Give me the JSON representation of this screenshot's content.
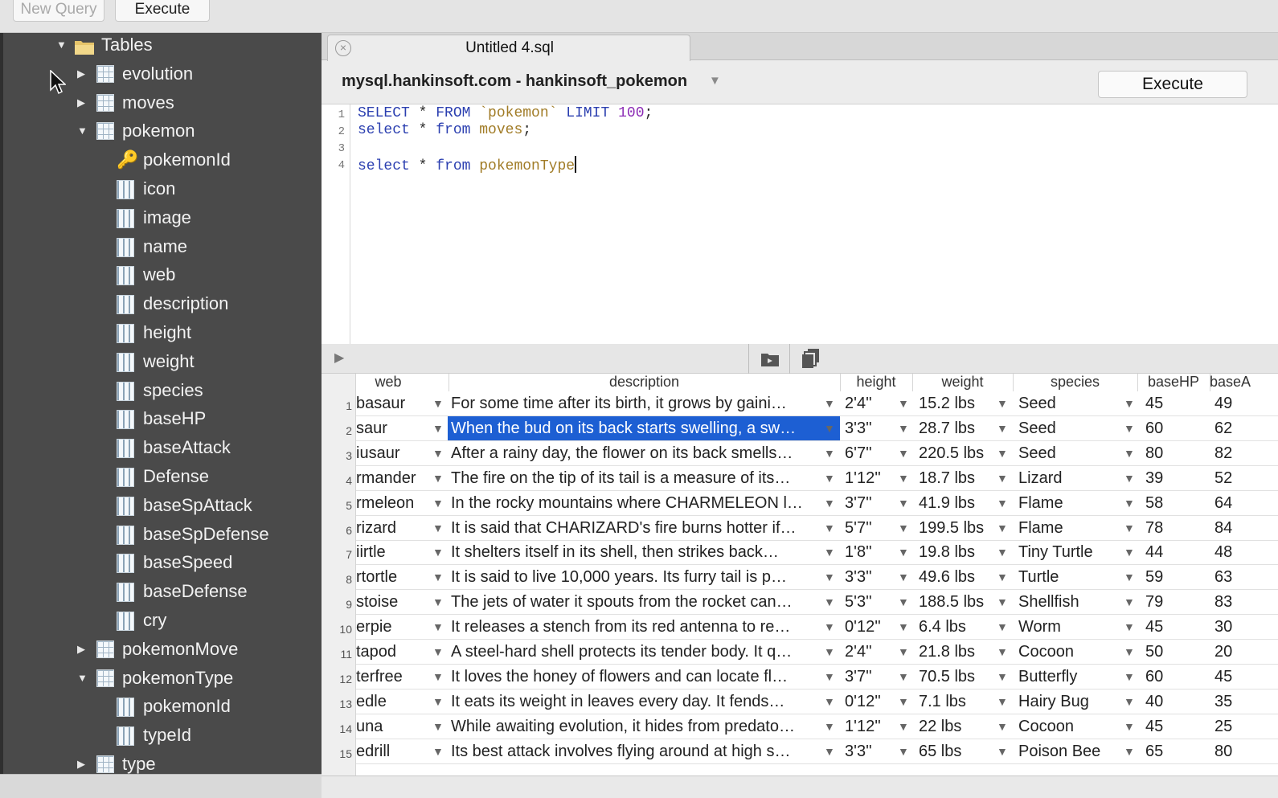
{
  "toolbar": {
    "new_query": "New Query",
    "execute": "Execute"
  },
  "sidebar": {
    "items": [
      {
        "label": "Tables",
        "kind": "folder",
        "level": 0,
        "state": "expanded"
      },
      {
        "label": "evolution",
        "kind": "table",
        "level": 1,
        "state": "collapsed"
      },
      {
        "label": "moves",
        "kind": "table",
        "level": 1,
        "state": "collapsed"
      },
      {
        "label": "pokemon",
        "kind": "table",
        "level": 1,
        "state": "expanded"
      },
      {
        "label": "pokemonId",
        "kind": "key",
        "level": 2
      },
      {
        "label": "icon",
        "kind": "column",
        "level": 2
      },
      {
        "label": "image",
        "kind": "column",
        "level": 2
      },
      {
        "label": "name",
        "kind": "column",
        "level": 2
      },
      {
        "label": "web",
        "kind": "column",
        "level": 2
      },
      {
        "label": "description",
        "kind": "column",
        "level": 2
      },
      {
        "label": "height",
        "kind": "column",
        "level": 2
      },
      {
        "label": "weight",
        "kind": "column",
        "level": 2
      },
      {
        "label": "species",
        "kind": "column",
        "level": 2
      },
      {
        "label": "baseHP",
        "kind": "column",
        "level": 2
      },
      {
        "label": "baseAttack",
        "kind": "column",
        "level": 2
      },
      {
        "label": "Defense",
        "kind": "column",
        "level": 2
      },
      {
        "label": "baseSpAttack",
        "kind": "column",
        "level": 2
      },
      {
        "label": "baseSpDefense",
        "kind": "column",
        "level": 2
      },
      {
        "label": "baseSpeed",
        "kind": "column",
        "level": 2
      },
      {
        "label": "baseDefense",
        "kind": "column",
        "level": 2
      },
      {
        "label": "cry",
        "kind": "column",
        "level": 2
      },
      {
        "label": "pokemonMove",
        "kind": "table",
        "level": 1,
        "state": "collapsed"
      },
      {
        "label": "pokemonType",
        "kind": "table",
        "level": 1,
        "state": "expanded"
      },
      {
        "label": "pokemonId",
        "kind": "column",
        "level": 2
      },
      {
        "label": "typeId",
        "kind": "column",
        "level": 2
      },
      {
        "label": "type",
        "kind": "table",
        "level": 1,
        "state": "collapsed"
      }
    ]
  },
  "tab": {
    "title": "Untitled 4.sql",
    "close_icon": "close-icon"
  },
  "connection": {
    "label": "mysql.hankinsoft.com - hankinsoft_pokemon",
    "execute": "Execute"
  },
  "editor": {
    "line_numbers": [
      "1",
      "2",
      "3",
      "4"
    ],
    "lines": [
      [
        {
          "t": "SELECT",
          "c": "kw"
        },
        {
          "t": " * "
        },
        {
          "t": "FROM",
          "c": "kw"
        },
        {
          "t": " "
        },
        {
          "t": "`pokemon`",
          "c": "str"
        },
        {
          "t": " "
        },
        {
          "t": "LIMIT",
          "c": "kw"
        },
        {
          "t": " "
        },
        {
          "t": "100",
          "c": "num"
        },
        {
          "t": ";"
        }
      ],
      [
        {
          "t": "select",
          "c": "kw"
        },
        {
          "t": " * "
        },
        {
          "t": "from",
          "c": "kw"
        },
        {
          "t": " "
        },
        {
          "t": "moves",
          "c": "str"
        },
        {
          "t": ";"
        }
      ],
      [],
      [
        {
          "t": "select",
          "c": "kw"
        },
        {
          "t": " * "
        },
        {
          "t": "from",
          "c": "kw"
        },
        {
          "t": " "
        },
        {
          "t": "pokemonType",
          "c": "str"
        }
      ]
    ]
  },
  "results": {
    "columns": [
      "web",
      "description",
      "height",
      "weight",
      "species",
      "baseHP",
      "baseA"
    ],
    "selected_row": 2,
    "rows": [
      {
        "n": "1",
        "web": "basaur",
        "description": "For some time after its birth, it grows by gaini…",
        "height": "2'4''",
        "weight": "15.2 lbs",
        "species": "Seed",
        "baseHP": "45",
        "baseA": "49"
      },
      {
        "n": "2",
        "web": "saur",
        "description": "When the bud on its back starts swelling, a sw…",
        "height": "3'3''",
        "weight": "28.7 lbs",
        "species": "Seed",
        "baseHP": "60",
        "baseA": "62"
      },
      {
        "n": "3",
        "web": "iusaur",
        "description": "After a rainy day, the flower on its back smells…",
        "height": "6'7''",
        "weight": "220.5 lbs",
        "species": "Seed",
        "baseHP": "80",
        "baseA": "82"
      },
      {
        "n": "4",
        "web": "rmander",
        "description": "The fire on the tip of its tail is a measure of its…",
        "height": "1'12''",
        "weight": "18.7 lbs",
        "species": "Lizard",
        "baseHP": "39",
        "baseA": "52"
      },
      {
        "n": "5",
        "web": "rmeleon",
        "description": "In the rocky mountains where CHARMELEON l…",
        "height": "3'7''",
        "weight": "41.9 lbs",
        "species": "Flame",
        "baseHP": "58",
        "baseA": "64"
      },
      {
        "n": "6",
        "web": "rizard",
        "description": "It is said that CHARIZARD's fire burns hotter if…",
        "height": "5'7''",
        "weight": "199.5 lbs",
        "species": "Flame",
        "baseHP": "78",
        "baseA": "84"
      },
      {
        "n": "7",
        "web": "iirtle",
        "description": "It shelters itself in its shell, then strikes back…",
        "height": "1'8''",
        "weight": "19.8 lbs",
        "species": "Tiny Turtle",
        "baseHP": "44",
        "baseA": "48"
      },
      {
        "n": "8",
        "web": "rtortle",
        "description": "It is said to live 10,000 years. Its furry tail is p…",
        "height": "3'3''",
        "weight": "49.6 lbs",
        "species": "Turtle",
        "baseHP": "59",
        "baseA": "63"
      },
      {
        "n": "9",
        "web": "stoise",
        "description": "The jets of water it spouts from the rocket can…",
        "height": "5'3''",
        "weight": "188.5 lbs",
        "species": "Shellfish",
        "baseHP": "79",
        "baseA": "83"
      },
      {
        "n": "10",
        "web": "erpie",
        "description": "It releases a stench from its red antenna to re…",
        "height": "0'12''",
        "weight": "6.4 lbs",
        "species": "Worm",
        "baseHP": "45",
        "baseA": "30"
      },
      {
        "n": "11",
        "web": "tapod",
        "description": "A steel-hard shell protects its tender body. It q…",
        "height": "2'4''",
        "weight": "21.8 lbs",
        "species": "Cocoon",
        "baseHP": "50",
        "baseA": "20"
      },
      {
        "n": "12",
        "web": "terfree",
        "description": "It loves the honey of flowers and can locate fl…",
        "height": "3'7''",
        "weight": "70.5 lbs",
        "species": "Butterfly",
        "baseHP": "60",
        "baseA": "45"
      },
      {
        "n": "13",
        "web": "edle",
        "description": "It eats its weight in leaves every day. It fends…",
        "height": "0'12''",
        "weight": "7.1 lbs",
        "species": "Hairy Bug",
        "baseHP": "40",
        "baseA": "35"
      },
      {
        "n": "14",
        "web": "una",
        "description": "While awaiting evolution, it hides from predato…",
        "height": "1'12''",
        "weight": "22 lbs",
        "species": "Cocoon",
        "baseHP": "45",
        "baseA": "25"
      },
      {
        "n": "15",
        "web": "edrill",
        "description": "Its best attack involves flying around at high s…",
        "height": "3'3''",
        "weight": "65 lbs",
        "species": "Poison Bee",
        "baseHP": "65",
        "baseA": "80"
      }
    ]
  }
}
